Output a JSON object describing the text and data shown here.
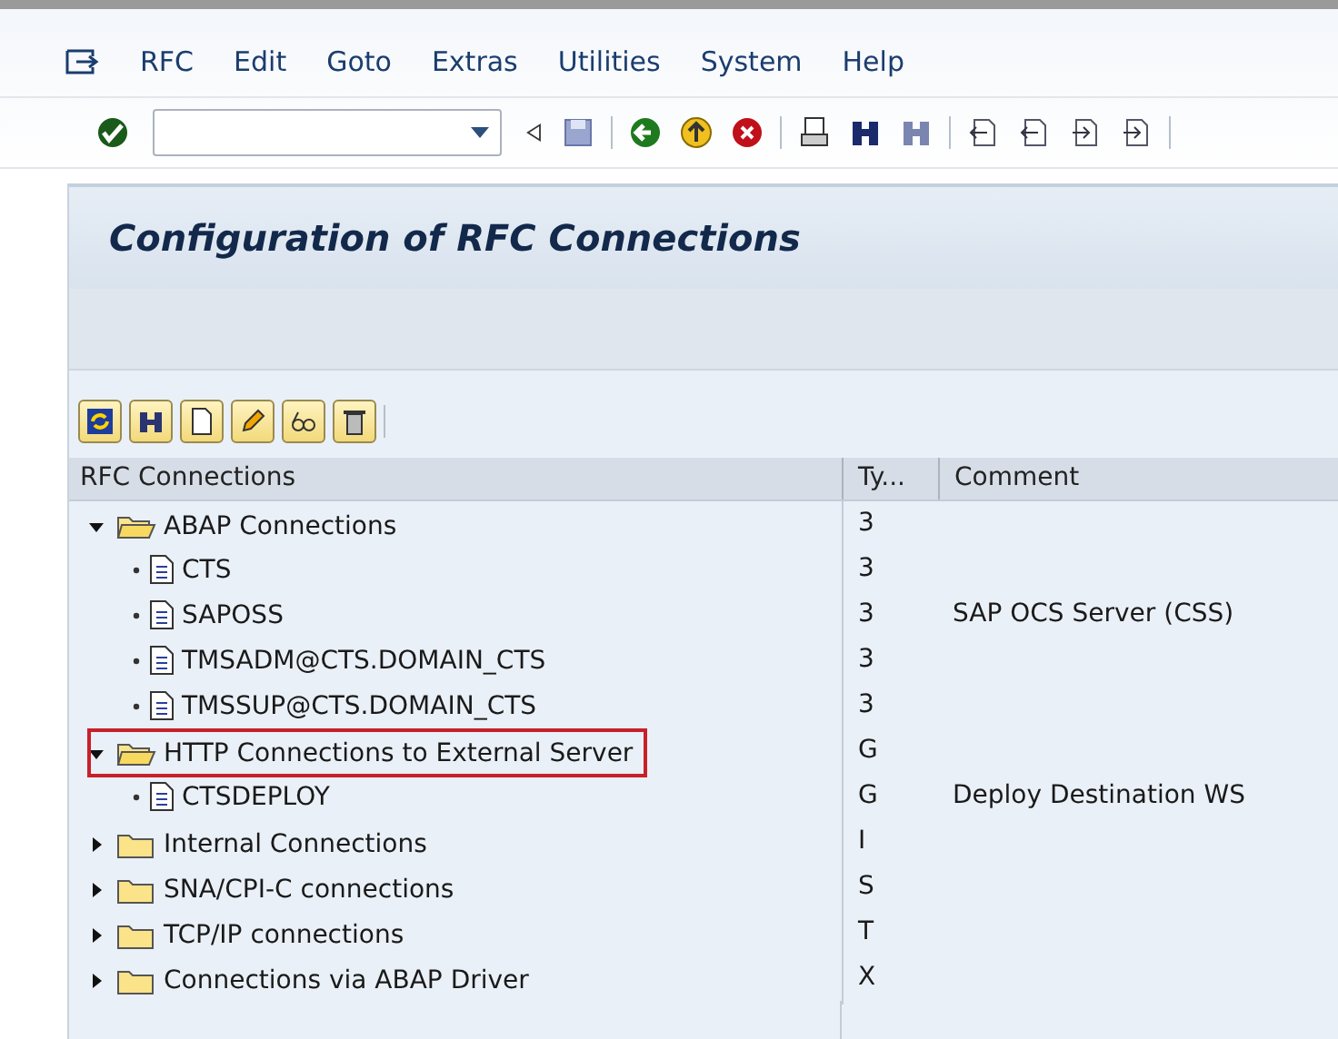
{
  "menu": [
    "RFC",
    "Edit",
    "Goto",
    "Extras",
    "Utilities",
    "System",
    "Help"
  ],
  "title": "Configuration of RFC Connections",
  "table": {
    "columns": [
      "RFC Connections",
      "Ty...",
      "Comment"
    ],
    "rows": [
      {
        "kind": "folder",
        "name": "ABAP Connections",
        "type": "3",
        "expanded": true,
        "highlighted": false,
        "children": [
          {
            "kind": "leaf",
            "name": "CTS",
            "type": "3"
          },
          {
            "kind": "leaf",
            "name": "SAPOSS",
            "type": "3",
            "comment": "SAP OCS Server (CSS)"
          },
          {
            "kind": "leaf",
            "name": "TMSADM@CTS.DOMAIN_CTS",
            "type": "3"
          },
          {
            "kind": "leaf",
            "name": "TMSSUP@CTS.DOMAIN_CTS",
            "type": "3"
          }
        ]
      },
      {
        "kind": "folder",
        "name": "HTTP Connections to External Server",
        "type": "G",
        "expanded": true,
        "highlighted": true,
        "children": [
          {
            "kind": "leaf",
            "name": "CTSDEPLOY",
            "type": "G",
            "comment": "Deploy Destination WS"
          }
        ]
      },
      {
        "kind": "folder",
        "name": "Internal Connections",
        "type": "I",
        "expanded": false,
        "highlighted": false
      },
      {
        "kind": "folder",
        "name": "SNA/CPI-C connections",
        "type": "S",
        "expanded": false,
        "highlighted": false
      },
      {
        "kind": "folder",
        "name": "TCP/IP connections",
        "type": "T",
        "expanded": false,
        "highlighted": false
      },
      {
        "kind": "folder",
        "name": "Connections via ABAP Driver",
        "type": "X",
        "expanded": false,
        "highlighted": false
      }
    ]
  }
}
